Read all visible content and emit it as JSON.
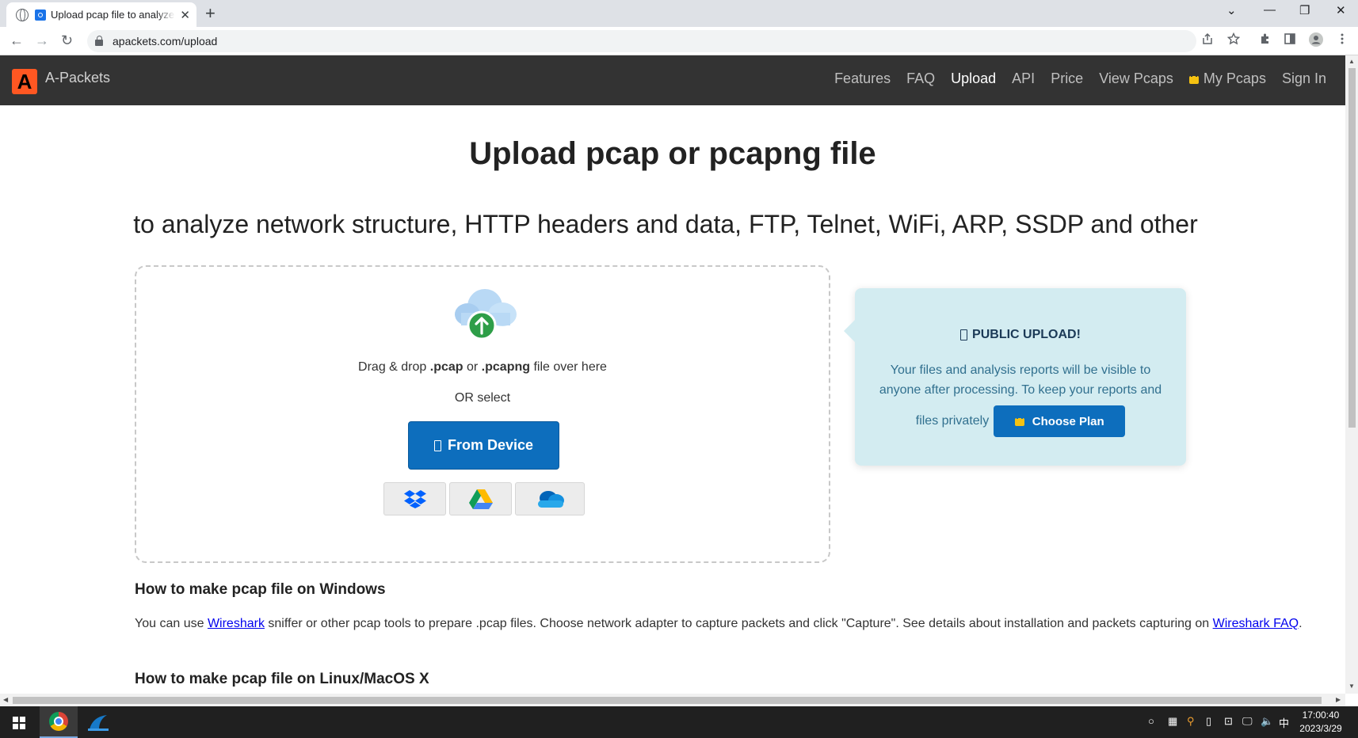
{
  "browser": {
    "tab_title": "Upload pcap file to analyze",
    "tab_close": "✕",
    "new_tab": "+",
    "url": "apackets.com/upload",
    "window_controls": {
      "menu": "⌄",
      "minimize": "—",
      "restore": "❐",
      "close": "✕"
    },
    "nav": {
      "back": "←",
      "forward": "→",
      "reload": "↻"
    },
    "toolbar_icons": [
      "share-icon",
      "star-icon",
      "extensions-icon",
      "sidepanel-icon",
      "profile-icon",
      "menu-icon"
    ]
  },
  "site": {
    "logo_letter": "A",
    "brand": "A-Packets",
    "nav": [
      "Features",
      "FAQ",
      "Upload",
      "API",
      "Price",
      "View Pcaps",
      "My Pcaps",
      "Sign In"
    ],
    "active_nav": "Upload",
    "colors": {
      "navbar": "#333333",
      "accent": "#ff5722",
      "primary_button": "#0d6ebd",
      "notice_bg": "#d3ecf1"
    }
  },
  "main": {
    "title": "Upload pcap or pcapng file",
    "subtitle": "to analyze network structure, HTTP headers and data, FTP, Telnet, WiFi, ARP, SSDP and other",
    "dropzone": {
      "drag_prefix": "Drag & drop ",
      "ext1": ".pcap",
      "or_word": " or ",
      "ext2": ".pcapng",
      "drag_suffix": " file over here",
      "or_select": "OR select",
      "device_button": "From Device",
      "cloud_services": [
        "dropbox-icon",
        "google-drive-icon",
        "onedrive-icon"
      ]
    },
    "notice": {
      "title": "PUBLIC UPLOAD!",
      "body": "Your files and analysis reports will be visible to anyone after processing. To keep your reports and",
      "tail": "files privately",
      "button": "Choose Plan"
    },
    "windows": {
      "heading": "How to make pcap file on Windows",
      "text_1": "You can use ",
      "link_1": "Wireshark",
      "text_2": " sniffer or other pcap tools to prepare .pcap files. Choose network adapter to capture packets and click \"Capture\". See details about installation and packets capturing on ",
      "link_2": "Wireshark FAQ",
      "text_3": "."
    },
    "linux": {
      "heading": "How to make pcap file on Linux/MacOS X"
    }
  },
  "taskbar": {
    "apps": [
      "chrome-icon",
      "wireshark-icon"
    ],
    "tray": [
      "○",
      "▦",
      "⚲",
      "▯",
      "⊡",
      "🖵",
      "🔈",
      "中"
    ],
    "time": "17:00:40",
    "date": "2023/3/29"
  }
}
